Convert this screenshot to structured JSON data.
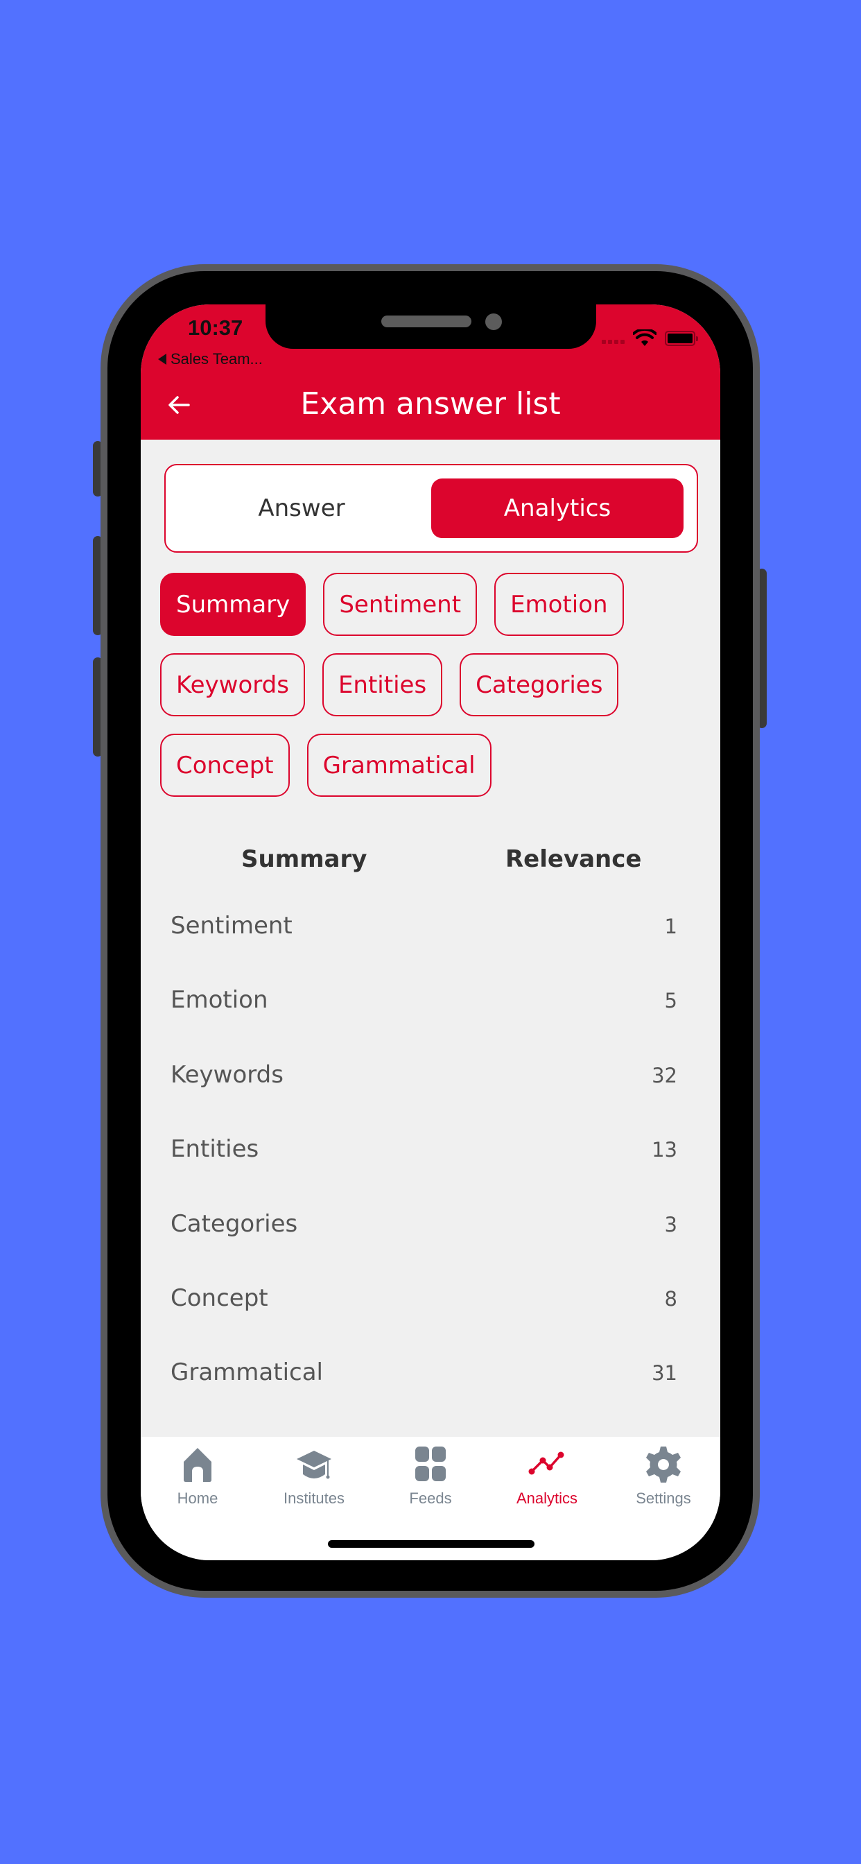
{
  "status_bar": {
    "time": "10:37",
    "back_app": "Sales Team..."
  },
  "header": {
    "title": "Exam answer list",
    "background": "#DC052D"
  },
  "segment": {
    "tabs": [
      {
        "label": "Answer",
        "active": false
      },
      {
        "label": "Analytics",
        "active": true
      }
    ]
  },
  "filters": {
    "chips": [
      {
        "label": "Summary",
        "selected": true
      },
      {
        "label": "Sentiment",
        "selected": false
      },
      {
        "label": "Emotion",
        "selected": false
      },
      {
        "label": "Keywords",
        "selected": false
      },
      {
        "label": "Entities",
        "selected": false
      },
      {
        "label": "Categories",
        "selected": false
      },
      {
        "label": "Concept",
        "selected": false
      },
      {
        "label": "Grammatical",
        "selected": false
      }
    ]
  },
  "table": {
    "columns": [
      "Summary",
      "Relevance"
    ],
    "rows": [
      {
        "name": "Sentiment",
        "value": "1"
      },
      {
        "name": "Emotion",
        "value": "5"
      },
      {
        "name": "Keywords",
        "value": "32"
      },
      {
        "name": "Entities",
        "value": "13"
      },
      {
        "name": "Categories",
        "value": "3"
      },
      {
        "name": "Concept",
        "value": "8"
      },
      {
        "name": "Grammatical",
        "value": "31"
      }
    ]
  },
  "tabbar": {
    "items": [
      {
        "label": "Home",
        "icon": "home-icon",
        "active": false
      },
      {
        "label": "Institutes",
        "icon": "graduation-cap-icon",
        "active": false
      },
      {
        "label": "Feeds",
        "icon": "grid-icon",
        "active": false
      },
      {
        "label": "Analytics",
        "icon": "analytics-line-icon",
        "active": true
      },
      {
        "label": "Settings",
        "icon": "gear-icon",
        "active": false
      }
    ]
  },
  "colors": {
    "accent": "#DC052D",
    "background": "#5271FF",
    "screen_bg": "#F0F0F0",
    "tab_inactive": "#7A8590"
  }
}
